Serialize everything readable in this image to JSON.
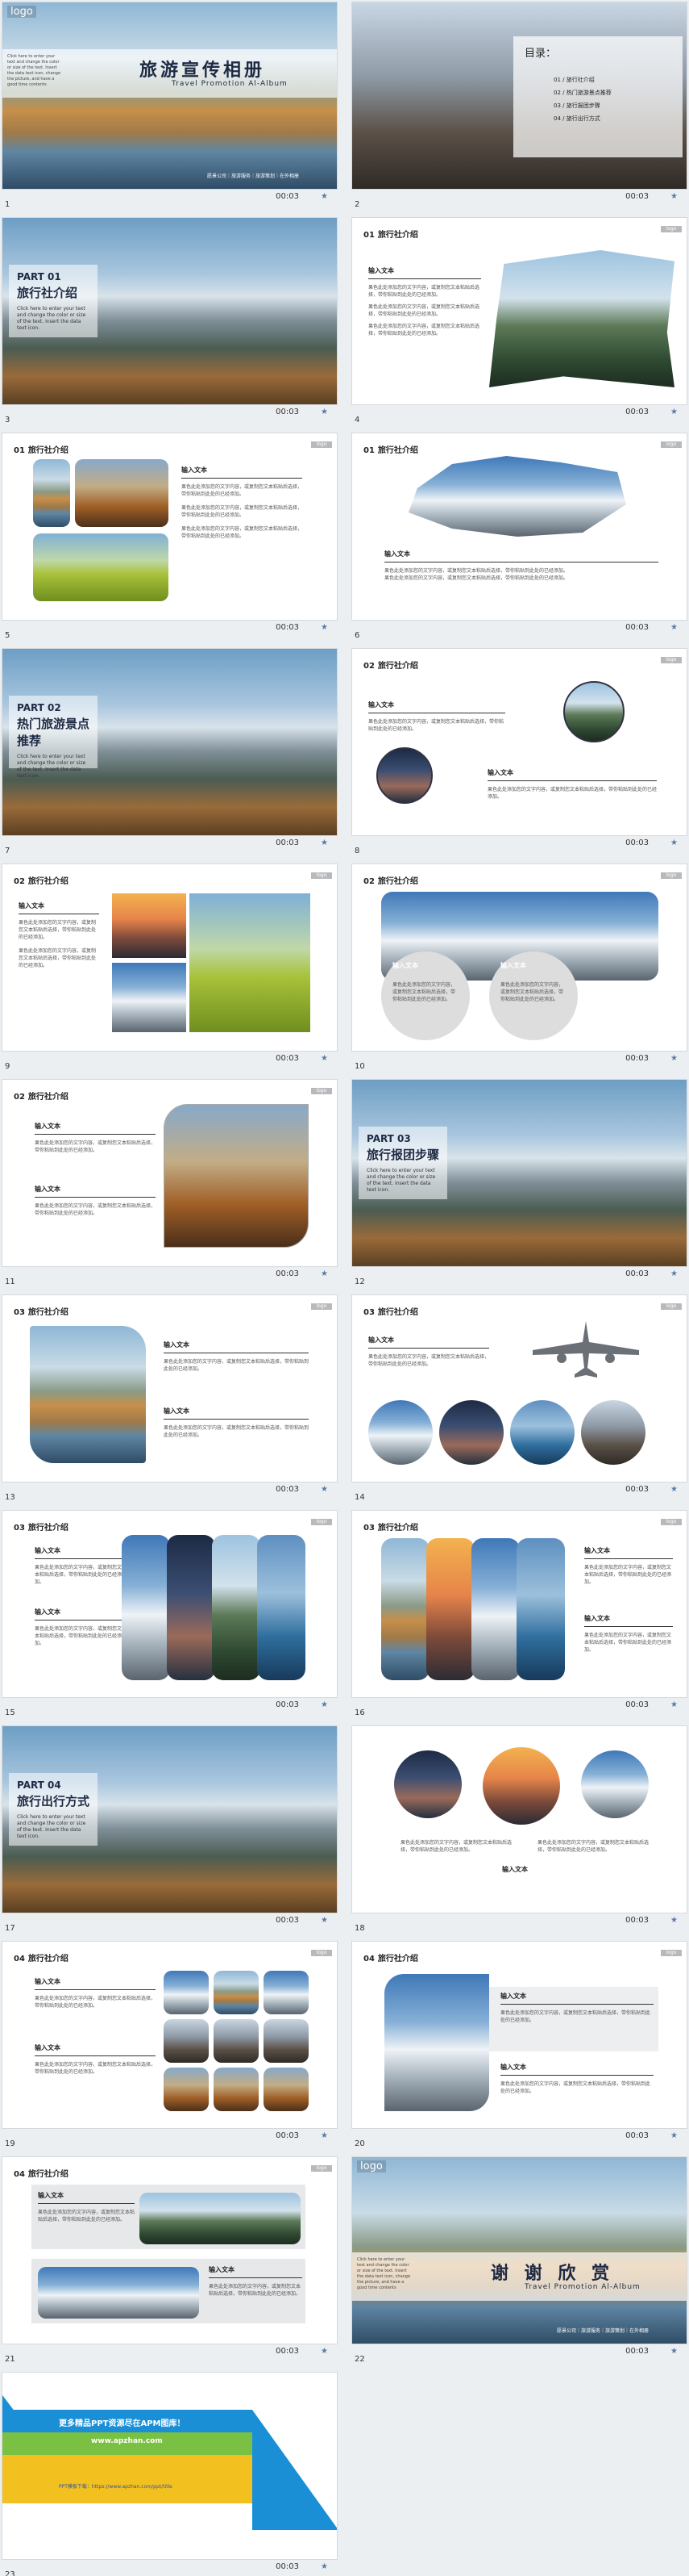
{
  "footer": {
    "time": "00:03",
    "star": "★"
  },
  "colors": {
    "dark_navy": "#1e2a44",
    "tag_gray": "#b7b9bc",
    "banner_blue": "#1a8fd6",
    "banner_green": "#7ac143",
    "banner_yellow": "#f2c01f"
  },
  "common": {
    "section_header": "旅行社介绍",
    "tag": "logo",
    "input_title": "输入文本",
    "body": "果色此处添加您的文字内容，或复制您文本粘贴后选择，带你粘贴到此处的已经添加。",
    "click_hint": "Click here to enter your text and change the color or size of the text. Insert the data text icon."
  },
  "slides": [
    {
      "n": "1",
      "title_cn": "旅游宣传相册",
      "title_en": "Travel Promotion Al-Album",
      "logo": "logo",
      "hint": "Click here to enter your text and change the color or size of the text. Insert the data text icon, change the picture, and have a good time contents",
      "links": "愿景公司｜旅游服务｜旅游策划｜在外相册"
    },
    {
      "n": "2",
      "toc_title": "目录：",
      "toc": [
        "01 / 旅行社介绍",
        "02 / 热门旅游景点推荐",
        "03 / 旅行报团步骤",
        "04 / 旅行出行方式"
      ]
    },
    {
      "n": "3",
      "part": "PART 01",
      "part_title": "旅行社介绍"
    },
    {
      "n": "4",
      "pn": "01"
    },
    {
      "n": "5",
      "pn": "01"
    },
    {
      "n": "6",
      "pn": "01"
    },
    {
      "n": "7",
      "part": "PART 02",
      "part_title": "热门旅游景点推荐"
    },
    {
      "n": "8",
      "pn": "02"
    },
    {
      "n": "9",
      "pn": "02"
    },
    {
      "n": "10",
      "pn": "02"
    },
    {
      "n": "11",
      "pn": "02"
    },
    {
      "n": "12",
      "part": "PART 03",
      "part_title": "旅行报团步骤"
    },
    {
      "n": "13",
      "pn": "03"
    },
    {
      "n": "14",
      "pn": "03"
    },
    {
      "n": "15",
      "pn": "03"
    },
    {
      "n": "16",
      "pn": "03"
    },
    {
      "n": "17",
      "part": "PART 04",
      "part_title": "旅行出行方式"
    },
    {
      "n": "18",
      "pn": "04"
    },
    {
      "n": "19",
      "pn": "04"
    },
    {
      "n": "20",
      "pn": "04"
    },
    {
      "n": "21",
      "pn": "04"
    },
    {
      "n": "22",
      "title_cn": "谢 谢 欣 赏",
      "title_en": "Travel Promotion Al-Album",
      "logo": "logo",
      "hint": "Click here to enter your text and change the color or size of the text. Insert the data text icon, change the picture, and have a good time contents",
      "links": "愿景公司｜旅游服务｜旅游策划｜在外相册"
    },
    {
      "n": "23",
      "ad_line1": "更多精品PPT资源尽在APM图库！",
      "ad_line2": "www.apzhan.com",
      "ad_line3": "PPT模板下载：https://www.apzhan.com/ppt/title"
    }
  ]
}
